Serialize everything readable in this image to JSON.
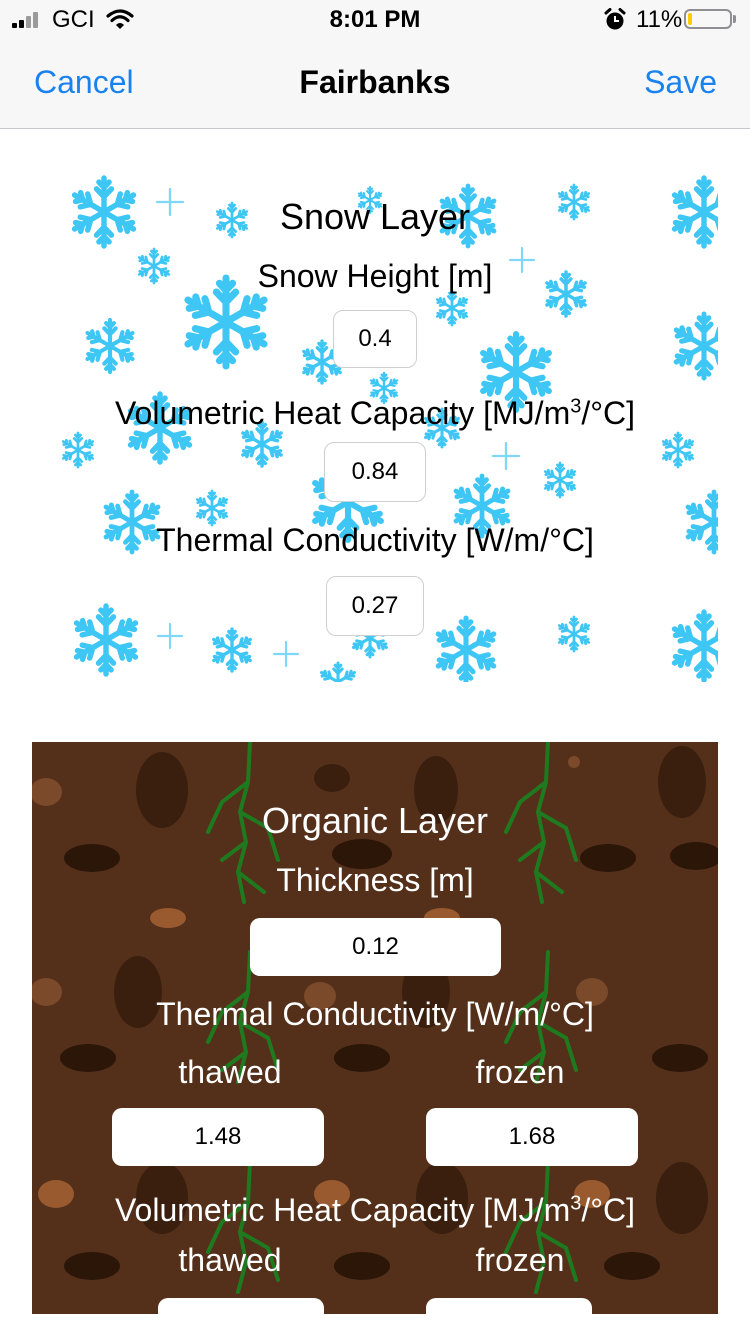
{
  "status_bar": {
    "carrier": "GCI",
    "time": "8:01 PM",
    "battery_percent": "11%",
    "battery_level": 0.11
  },
  "nav": {
    "cancel_label": "Cancel",
    "title": "Fairbanks",
    "save_label": "Save"
  },
  "snow_layer": {
    "title": "Snow Layer",
    "height_label": "Snow Height [m]",
    "height_value": "0.4",
    "vhc_label_pre": "Volumetric Heat Capacity [MJ/m",
    "vhc_label_sup": "3",
    "vhc_label_post": "/°C]",
    "vhc_value": "0.84",
    "tc_label": "Thermal Conductivity [W/m/°C]",
    "tc_value": "0.27"
  },
  "organic_layer": {
    "title": "Organic Layer",
    "thickness_label": "Thickness [m]",
    "thickness_value": "0.12",
    "tc_label": "Thermal Conductivity [W/m/°C]",
    "thawed_label": "thawed",
    "frozen_label": "frozen",
    "tc_thawed_value": "1.48",
    "tc_frozen_value": "1.68",
    "vhc_label_pre": "Volumetric Heat Capacity [MJ/m",
    "vhc_label_sup": "3",
    "vhc_label_post": "/°C]",
    "vhc_thawed_label": "thawed",
    "vhc_frozen_label": "frozen",
    "vhc_thawed_value": "",
    "vhc_frozen_value": ""
  },
  "colors": {
    "accent": "#1a82ee",
    "snowflake": "#3ec6f5",
    "soil": "#54301b"
  }
}
